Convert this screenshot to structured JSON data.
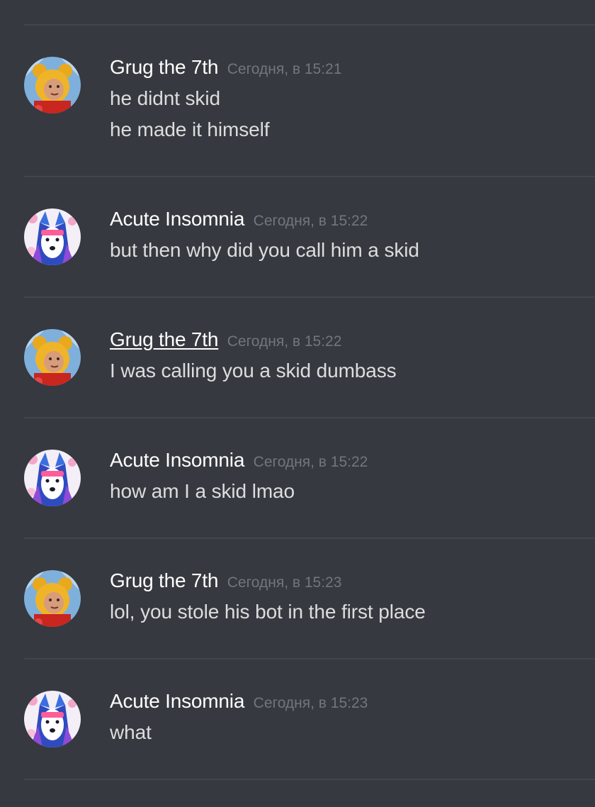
{
  "colors": {
    "background": "#36393f",
    "divider": "#42454b",
    "username": "#ffffff",
    "timestamp": "#72767d",
    "message_text": "#dcddde"
  },
  "avatars": {
    "grug": "pooh-bear-avatar",
    "acute": "anime-wolf-avatar"
  },
  "messages": [
    {
      "author": "Grug the 7th",
      "timestamp": "Сегодня, в 15:21",
      "lines": [
        "he didnt skid",
        "he made it himself"
      ]
    },
    {
      "author": "Acute Insomnia",
      "timestamp": "Сегодня, в 15:22",
      "lines": [
        "but then why did you call him a skid"
      ]
    },
    {
      "author": "Grug the 7th",
      "timestamp": "Сегодня, в 15:22",
      "lines": [
        "I was calling you a skid dumbass"
      ]
    },
    {
      "author": "Acute Insomnia",
      "timestamp": "Сегодня, в 15:22",
      "lines": [
        "how am I a skid lmao"
      ]
    },
    {
      "author": "Grug the 7th",
      "timestamp": "Сегодня, в 15:23",
      "lines": [
        "lol, you stole his bot in the first place"
      ]
    },
    {
      "author": "Acute Insomnia",
      "timestamp": "Сегодня, в 15:23",
      "lines": [
        "what"
      ]
    }
  ]
}
